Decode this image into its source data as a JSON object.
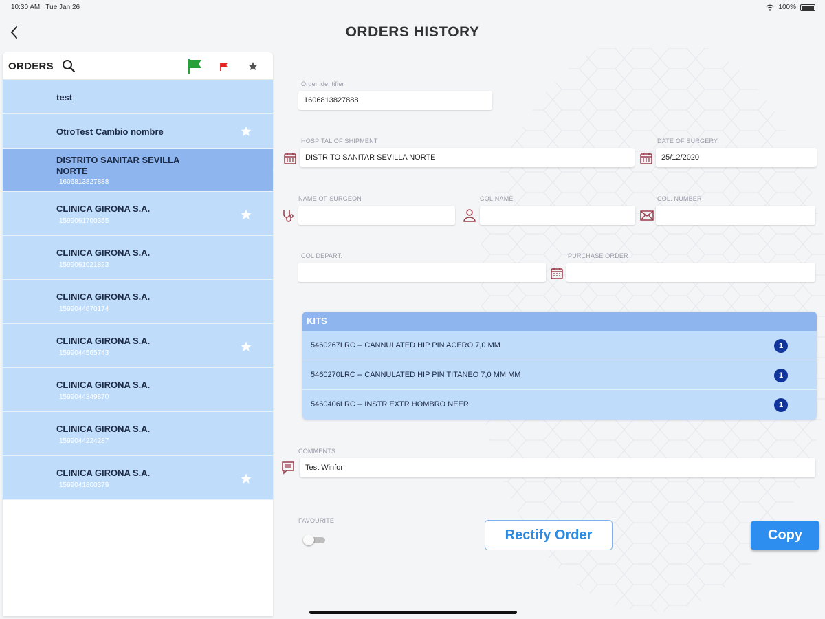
{
  "status_bar": {
    "time": "10:30 AM",
    "date": "Tue Jan 26",
    "battery": "100%"
  },
  "header": {
    "title": "ORDERS HISTORY"
  },
  "sidebar": {
    "title": "ORDERS",
    "items": [
      {
        "name": "test",
        "id": "",
        "starred": false,
        "selected": false
      },
      {
        "name": "OtroTest Cambio nombre",
        "id": "",
        "starred": true,
        "selected": false
      },
      {
        "name": "DISTRITO SANITAR SEVILLA NORTE",
        "id": "1606813827888",
        "starred": false,
        "selected": true
      },
      {
        "name": "CLINICA GIRONA S.A.",
        "id": "1599061700355",
        "starred": true,
        "selected": false
      },
      {
        "name": "CLINICA GIRONA S.A.",
        "id": "1599061021823",
        "starred": false,
        "selected": false
      },
      {
        "name": "CLINICA GIRONA S.A.",
        "id": "1599044670174",
        "starred": false,
        "selected": false
      },
      {
        "name": "CLINICA GIRONA S.A.",
        "id": "1599044565743",
        "starred": true,
        "selected": false
      },
      {
        "name": "CLINICA GIRONA S.A.",
        "id": "1599044349870",
        "starred": false,
        "selected": false
      },
      {
        "name": "CLINICA GIRONA S.A.",
        "id": "1599044224287",
        "starred": false,
        "selected": false
      },
      {
        "name": "CLINICA GIRONA S.A.",
        "id": "1599041800379",
        "starred": true,
        "selected": false
      }
    ]
  },
  "form": {
    "order_identifier": {
      "label": "Order identifier",
      "value": "1606813827888"
    },
    "hospital": {
      "label": "HOSPITAL OF SHIPMENT",
      "value": "DISTRITO SANITAR SEVILLA NORTE"
    },
    "date_of_surgery": {
      "label": "DATE OF SURGERY",
      "value": "25/12/2020"
    },
    "surgeon": {
      "label": "NAME OF SURGEON",
      "value": ""
    },
    "col_name": {
      "label": "COL.NAME",
      "value": ""
    },
    "col_number": {
      "label": "COL. NUMBER",
      "value": ""
    },
    "col_depart": {
      "label": "COL DEPART.",
      "value": ""
    },
    "purchase_order": {
      "label": "PURCHASE ORDER",
      "value": ""
    },
    "kits": {
      "title": "KITS",
      "items": [
        {
          "text": "5460267LRC -- CANNULATED HIP PIN  ACERO  7,0 MM",
          "qty": "1"
        },
        {
          "text": "5460270LRC -- CANNULATED HIP PIN  TITANEO  7,0 MM MM",
          "qty": "1"
        },
        {
          "text": "5460406LRC -- INSTR EXTR HOMBRO NEER",
          "qty": "1"
        }
      ]
    },
    "comments": {
      "label": "COMMENTS",
      "value": "Test Winfor"
    },
    "favourite": {
      "label": "FAVOURITE",
      "on": false
    }
  },
  "buttons": {
    "rectify": "Rectify Order",
    "copy": "Copy"
  },
  "colors": {
    "list_item": "#bfdcfb",
    "list_selected": "#8fb5ee",
    "accent": "#2d8ef0",
    "badge": "#11359a",
    "icon": "#9a3b4a"
  }
}
